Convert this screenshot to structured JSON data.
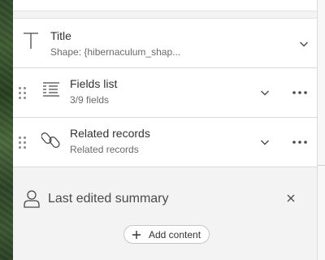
{
  "cards": {
    "title": {
      "label": "Title",
      "subtitle": "Shape: {hibernaculum_shap..."
    },
    "fields": {
      "label": "Fields list",
      "subtitle": "3/9 fields"
    },
    "related": {
      "label": "Related records",
      "subtitle": "Related records"
    }
  },
  "summary": {
    "label": "Last edited summary",
    "add_button_label": "Add content"
  },
  "icons": {
    "title": "text-icon",
    "fields": "list-icon",
    "related": "link-icon",
    "expand": "chevron-down-icon",
    "more": "ellipsis-icon",
    "drag": "drag-handle-icon",
    "person": "person-icon",
    "close": "close-icon",
    "add": "plus-icon"
  },
  "colors": {
    "panel_bg": "#f3f3f3",
    "card_bg": "#ffffff",
    "text": "#323232",
    "subtext": "#6a6a6a"
  }
}
